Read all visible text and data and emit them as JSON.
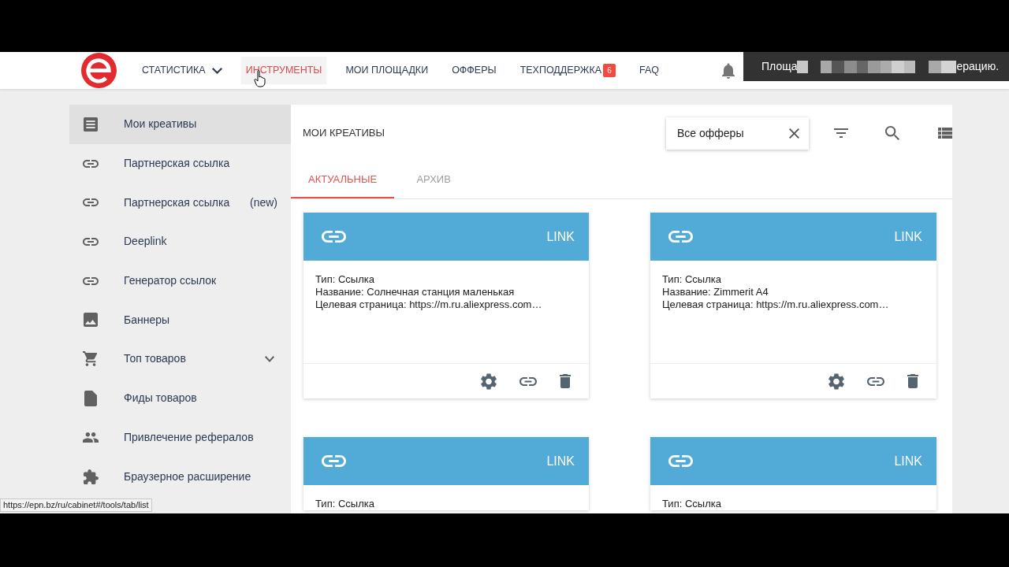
{
  "navbar": {
    "items": [
      {
        "label": "СТАТИСТИКА",
        "kind": "dropdown",
        "selected": false,
        "hovered": false
      },
      {
        "label": "ИНСТРУМЕНТЫ",
        "kind": "link",
        "selected": true,
        "hovered": true
      },
      {
        "label": "МОИ ПЛОЩАДКИ",
        "kind": "link",
        "selected": false,
        "hovered": false
      },
      {
        "label": "ОФФЕРЫ",
        "kind": "link",
        "selected": false,
        "hovered": false
      },
      {
        "label": "ТЕХПОДДЕРЖКА",
        "kind": "link",
        "selected": false,
        "hovered": false,
        "badge": "6"
      },
      {
        "label": "FAQ",
        "kind": "link",
        "selected": false,
        "hovered": false
      }
    ]
  },
  "notification": {
    "text_start": "Площа",
    "text_end": "ерацию."
  },
  "sidebar": {
    "items": [
      {
        "label": "Мои креативы",
        "kind": "link",
        "selected": true
      },
      {
        "label": "Партнерская ссылка",
        "kind": "link",
        "selected": false
      },
      {
        "label": "Партнерская ссылка",
        "suffix": "(new)",
        "kind": "link",
        "selected": false
      },
      {
        "label": "Deeplink",
        "kind": "link",
        "selected": false
      },
      {
        "label": "Генератор ссылок",
        "kind": "link",
        "selected": false
      },
      {
        "label": "Баннеры",
        "kind": "link",
        "selected": false
      },
      {
        "label": "Топ товаров",
        "kind": "group",
        "expanded": false,
        "selected": false
      },
      {
        "label": "Фиды товаров",
        "kind": "link",
        "selected": false
      },
      {
        "label": "Привлечение рефералов",
        "kind": "link",
        "selected": false
      },
      {
        "label": "Браузерное расширение",
        "kind": "link",
        "selected": false
      }
    ]
  },
  "content": {
    "title": "МОИ КРЕАТИВЫ",
    "filter": {
      "value": "Все офферы"
    },
    "tabs": [
      {
        "label": "АКТУАЛЬНЫЕ",
        "selected": true
      },
      {
        "label": "АРХИВ",
        "selected": false
      }
    ],
    "cards": [
      {
        "label": "LINK",
        "lines": [
          "Тип: Ссылка",
          "Название: Солнечная станция маленькая",
          "Целевая страница: https://m.ru.aliexpress.com…"
        ],
        "actions_visible": true
      },
      {
        "label": "LINK",
        "lines": [
          "Тип: Ссылка",
          "Название: Zimmerit A4",
          "Целевая страница: https://m.ru.aliexpress.com…"
        ],
        "actions_visible": true
      },
      {
        "label": "LINK",
        "lines": [
          "Тип: Ссылка"
        ],
        "actions_visible": false
      },
      {
        "label": "LINK",
        "lines": [
          "Тип: Ссылка"
        ],
        "actions_visible": false
      }
    ]
  },
  "status_url": "https://epn.bz/ru/cabinet#/tools/tab/list"
}
